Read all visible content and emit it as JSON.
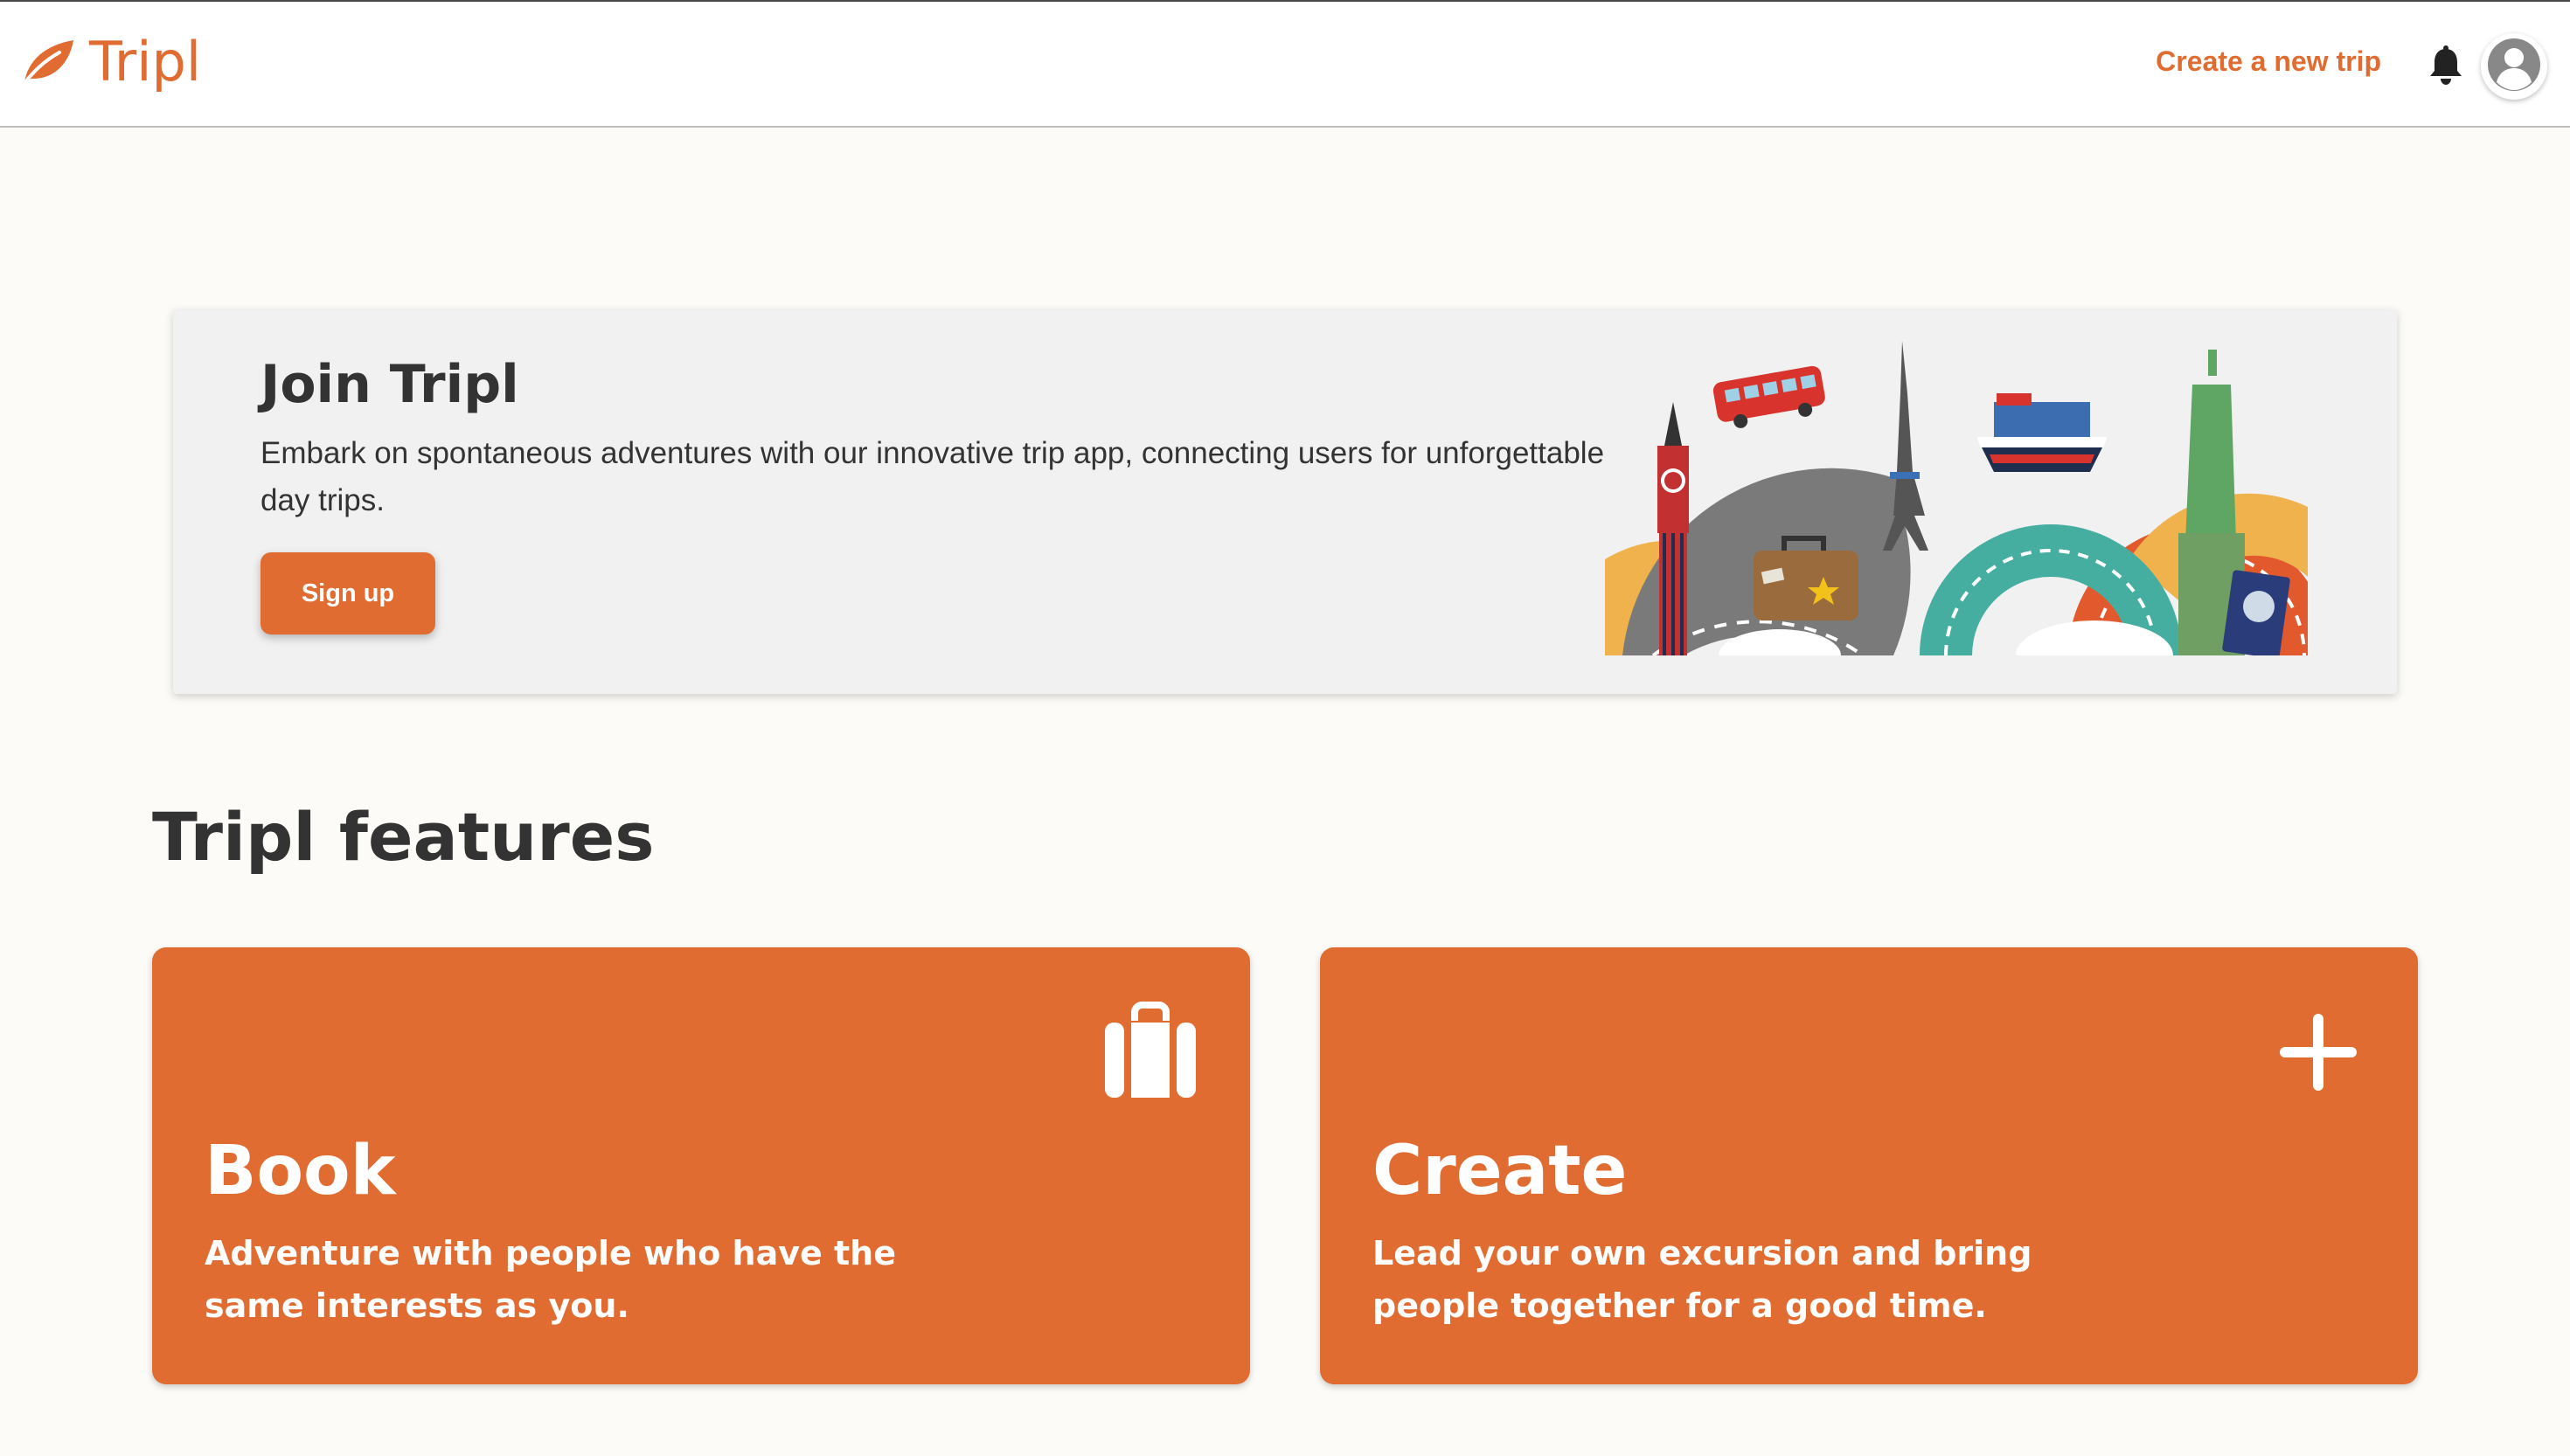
{
  "app": {
    "name": "Tripl",
    "brand_color": "#e06c31"
  },
  "header": {
    "create_trip_label": "Create a new trip",
    "icons": [
      "leaf-logo-icon",
      "bell-icon",
      "user-avatar-icon"
    ]
  },
  "hero": {
    "title": "Join Tripl",
    "description": "Embark on spontaneous adventures with our innovative trip app, connecting users for unforgettable day trips.",
    "signup_label": "Sign up"
  },
  "features": {
    "title": "Tripl features",
    "cards": [
      {
        "title": "Book",
        "description": "Adventure with people who have the same interests as you.",
        "icon": "suitcase-icon"
      },
      {
        "title": "Create",
        "description": "Lead your own excursion and bring people together for a good time.",
        "icon": "plus-icon"
      }
    ]
  }
}
